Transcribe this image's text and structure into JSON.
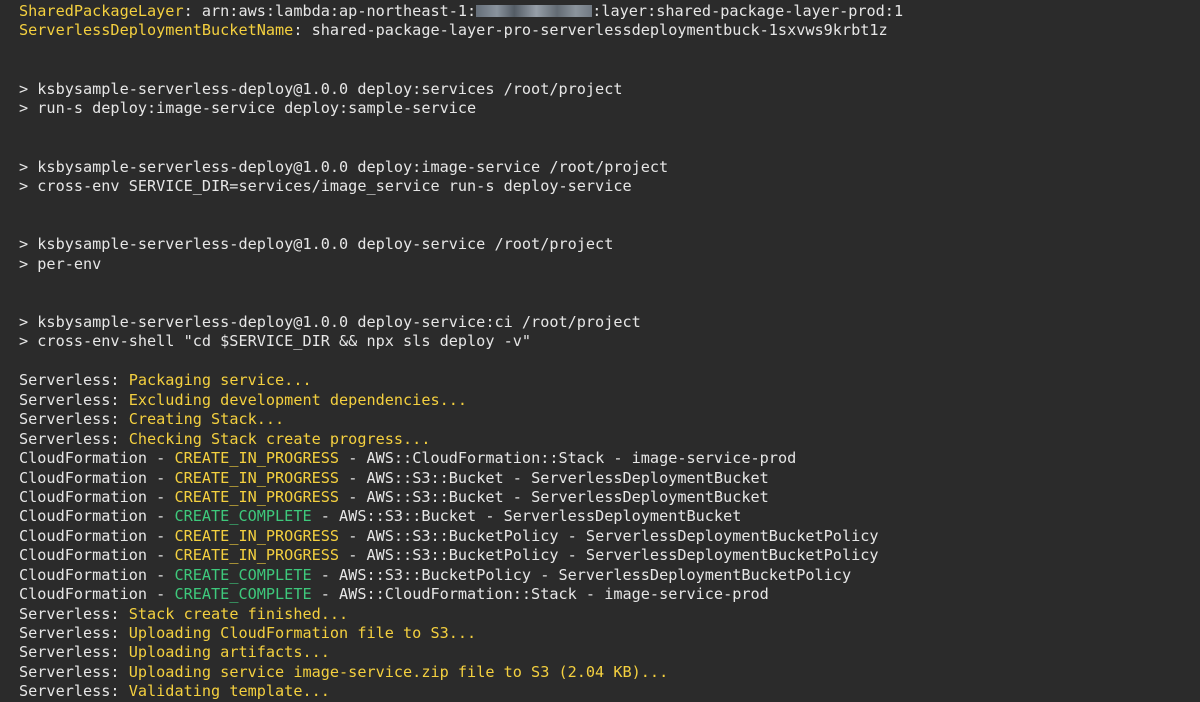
{
  "terminal": {
    "colors": {
      "background": "#2b2b2b",
      "default": "#e6e6e6",
      "yellow": "#f4d03f",
      "green": "#3ec97c"
    },
    "lines": [
      [
        {
          "t": "SharedPackageLayer",
          "c": "yellow"
        },
        {
          "t": ": arn:aws:lambda:ap-northeast-1:",
          "c": "default"
        },
        {
          "t": "",
          "c": "redacted"
        },
        {
          "t": ":layer:shared-package-layer-prod:1",
          "c": "default"
        }
      ],
      [
        {
          "t": "ServerlessDeploymentBucketName",
          "c": "yellow"
        },
        {
          "t": ": shared-package-layer-pro-serverlessdeploymentbuck-1sxvws9krbt1z",
          "c": "default"
        }
      ],
      [],
      [],
      [
        {
          "t": "> ksbysample-serverless-deploy@1.0.0 deploy:services /root/project",
          "c": "default"
        }
      ],
      [
        {
          "t": "> run-s deploy:image-service deploy:sample-service",
          "c": "default"
        }
      ],
      [],
      [],
      [
        {
          "t": "> ksbysample-serverless-deploy@1.0.0 deploy:image-service /root/project",
          "c": "default"
        }
      ],
      [
        {
          "t": "> cross-env SERVICE_DIR=services/image_service run-s deploy-service",
          "c": "default"
        }
      ],
      [],
      [],
      [
        {
          "t": "> ksbysample-serverless-deploy@1.0.0 deploy-service /root/project",
          "c": "default"
        }
      ],
      [
        {
          "t": "> per-env",
          "c": "default"
        }
      ],
      [],
      [],
      [
        {
          "t": "> ksbysample-serverless-deploy@1.0.0 deploy-service:ci /root/project",
          "c": "default"
        }
      ],
      [
        {
          "t": "> cross-env-shell \"cd $SERVICE_DIR && npx sls deploy -v\"",
          "c": "default"
        }
      ],
      [],
      [
        {
          "t": "Serverless: ",
          "c": "default"
        },
        {
          "t": "Packaging service...",
          "c": "yellow"
        }
      ],
      [
        {
          "t": "Serverless: ",
          "c": "default"
        },
        {
          "t": "Excluding development dependencies...",
          "c": "yellow"
        }
      ],
      [
        {
          "t": "Serverless: ",
          "c": "default"
        },
        {
          "t": "Creating Stack...",
          "c": "yellow"
        }
      ],
      [
        {
          "t": "Serverless: ",
          "c": "default"
        },
        {
          "t": "Checking Stack create progress...",
          "c": "yellow"
        }
      ],
      [
        {
          "t": "CloudFormation - ",
          "c": "default"
        },
        {
          "t": "CREATE_IN_PROGRESS",
          "c": "yellow"
        },
        {
          "t": " - AWS::CloudFormation::Stack - image-service-prod",
          "c": "default"
        }
      ],
      [
        {
          "t": "CloudFormation - ",
          "c": "default"
        },
        {
          "t": "CREATE_IN_PROGRESS",
          "c": "yellow"
        },
        {
          "t": " - AWS::S3::Bucket - ServerlessDeploymentBucket",
          "c": "default"
        }
      ],
      [
        {
          "t": "CloudFormation - ",
          "c": "default"
        },
        {
          "t": "CREATE_IN_PROGRESS",
          "c": "yellow"
        },
        {
          "t": " - AWS::S3::Bucket - ServerlessDeploymentBucket",
          "c": "default"
        }
      ],
      [
        {
          "t": "CloudFormation - ",
          "c": "default"
        },
        {
          "t": "CREATE_COMPLETE",
          "c": "green"
        },
        {
          "t": " - AWS::S3::Bucket - ServerlessDeploymentBucket",
          "c": "default"
        }
      ],
      [
        {
          "t": "CloudFormation - ",
          "c": "default"
        },
        {
          "t": "CREATE_IN_PROGRESS",
          "c": "yellow"
        },
        {
          "t": " - AWS::S3::BucketPolicy - ServerlessDeploymentBucketPolicy",
          "c": "default"
        }
      ],
      [
        {
          "t": "CloudFormation - ",
          "c": "default"
        },
        {
          "t": "CREATE_IN_PROGRESS",
          "c": "yellow"
        },
        {
          "t": " - AWS::S3::BucketPolicy - ServerlessDeploymentBucketPolicy",
          "c": "default"
        }
      ],
      [
        {
          "t": "CloudFormation - ",
          "c": "default"
        },
        {
          "t": "CREATE_COMPLETE",
          "c": "green"
        },
        {
          "t": " - AWS::S3::BucketPolicy - ServerlessDeploymentBucketPolicy",
          "c": "default"
        }
      ],
      [
        {
          "t": "CloudFormation - ",
          "c": "default"
        },
        {
          "t": "CREATE_COMPLETE",
          "c": "green"
        },
        {
          "t": " - AWS::CloudFormation::Stack - image-service-prod",
          "c": "default"
        }
      ],
      [
        {
          "t": "Serverless: ",
          "c": "default"
        },
        {
          "t": "Stack create finished...",
          "c": "yellow"
        }
      ],
      [
        {
          "t": "Serverless: ",
          "c": "default"
        },
        {
          "t": "Uploading CloudFormation file to S3...",
          "c": "yellow"
        }
      ],
      [
        {
          "t": "Serverless: ",
          "c": "default"
        },
        {
          "t": "Uploading artifacts...",
          "c": "yellow"
        }
      ],
      [
        {
          "t": "Serverless: ",
          "c": "default"
        },
        {
          "t": "Uploading service image-service.zip file to S3 (2.04 KB)...",
          "c": "yellow"
        }
      ],
      [
        {
          "t": "Serverless: ",
          "c": "default"
        },
        {
          "t": "Validating template...",
          "c": "yellow"
        }
      ]
    ]
  }
}
